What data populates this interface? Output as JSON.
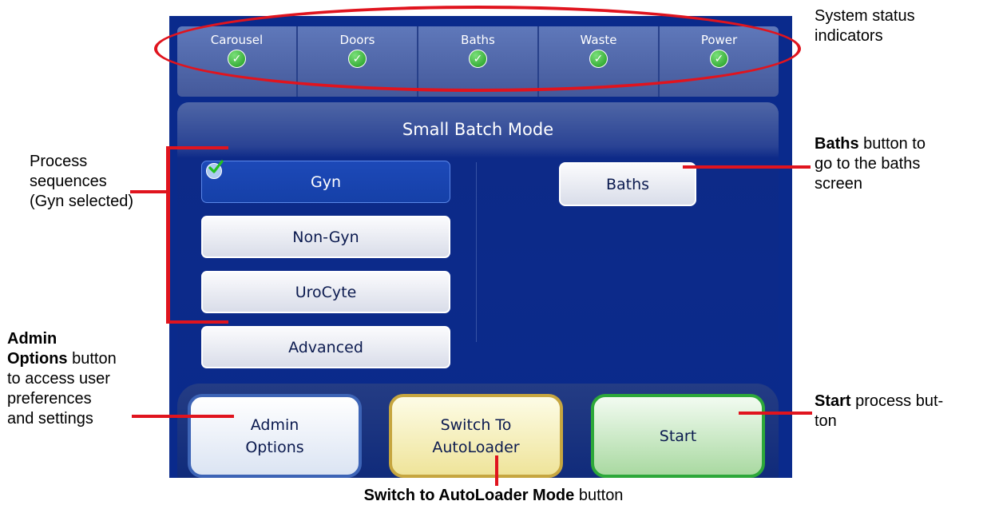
{
  "status_indicators": [
    {
      "label": "Carousel",
      "state": "ok",
      "icon": "check-circle-icon"
    },
    {
      "label": "Doors",
      "state": "ok",
      "icon": "check-circle-icon"
    },
    {
      "label": "Baths",
      "state": "ok",
      "icon": "check-circle-icon"
    },
    {
      "label": "Waste",
      "state": "ok",
      "icon": "check-circle-icon"
    },
    {
      "label": "Power",
      "state": "ok",
      "icon": "check-circle-icon"
    }
  ],
  "mode_title": "Small Batch Mode",
  "process_buttons": [
    {
      "label": "Gyn",
      "selected": true
    },
    {
      "label": "Non-Gyn",
      "selected": false
    },
    {
      "label": "UroCyte",
      "selected": false
    },
    {
      "label": "Advanced",
      "selected": false
    }
  ],
  "baths_button": "Baths",
  "bottom": {
    "admin_line1": "Admin",
    "admin_line2": "Options",
    "switch_line1": "Switch To",
    "switch_line2": "AutoLoader",
    "start": "Start"
  },
  "callouts": {
    "status_line1": "System status",
    "status_line2": "indicators",
    "process_line1": "Process",
    "process_line2": "sequences",
    "process_line3": "(Gyn selected)",
    "baths_bold": "Baths",
    "baths_rest1": "button to",
    "baths_line2": "go to the baths",
    "baths_line3": "screen",
    "admin_bold1": "Admin",
    "admin_bold2": "Options",
    "admin_rest1": "button",
    "admin_line3": "to access user",
    "admin_line4": "preferences",
    "admin_line5": "and settings",
    "start_bold": "Start",
    "start_rest1": "process but-",
    "start_line2": "ton",
    "switch_bold": "Switch to AutoLoader Mode",
    "switch_rest": "button"
  },
  "colors": {
    "screen_bg": "#0a2a8c",
    "callout_red": "#e0141e",
    "status_ok": "#2fb62f",
    "admin_border": "#3d64b6",
    "switch_border": "#c6a640",
    "start_border": "#2da83a"
  }
}
